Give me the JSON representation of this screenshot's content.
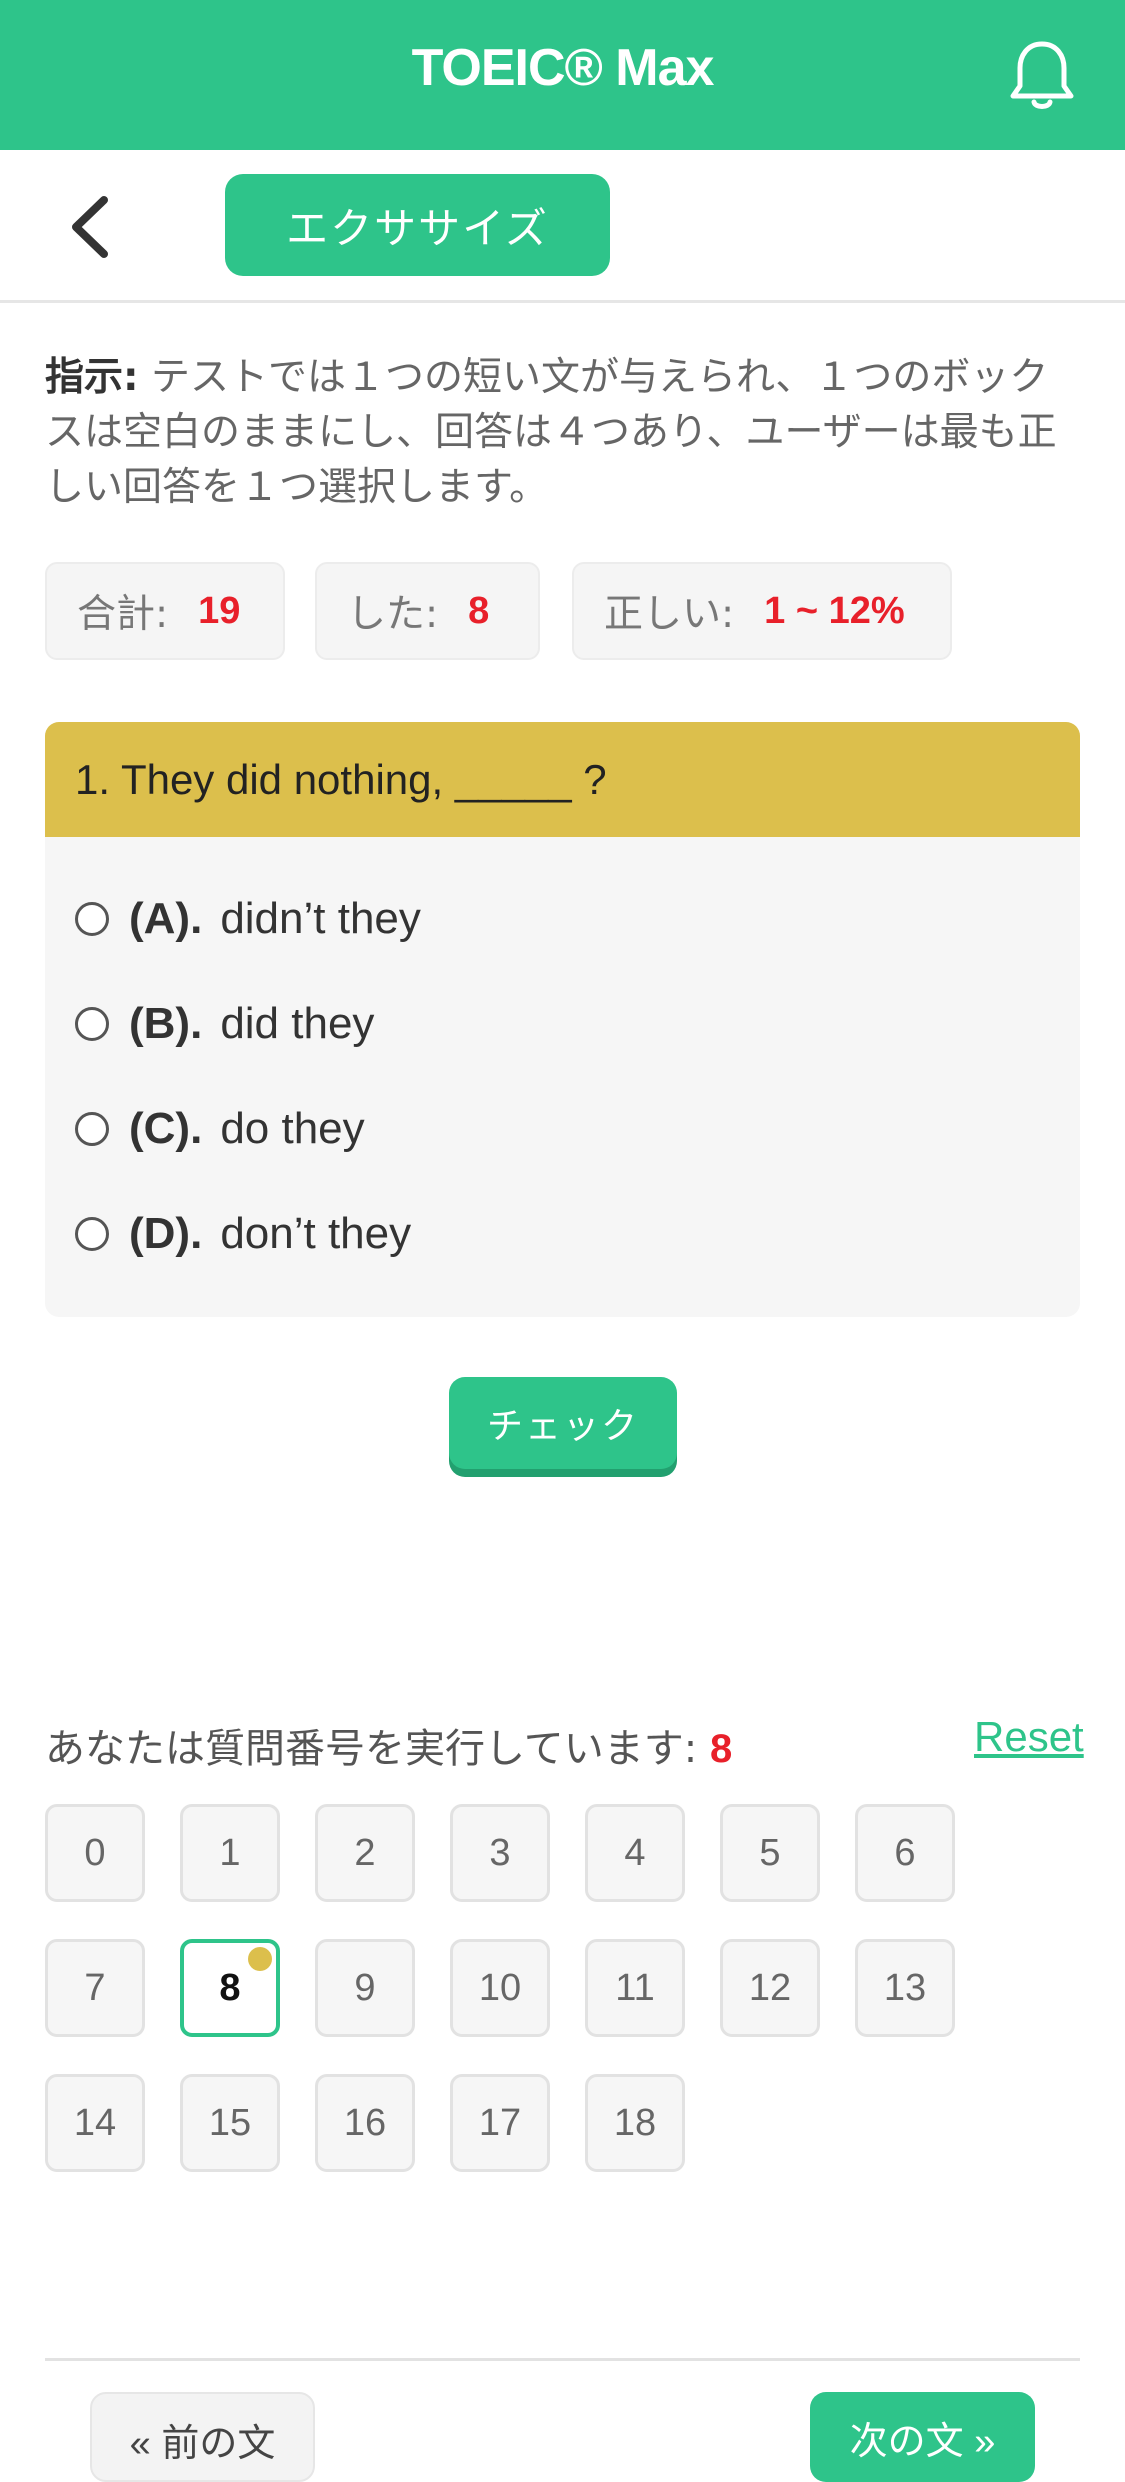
{
  "header": {
    "title": "TOEIC® Max",
    "icon": "bell-icon"
  },
  "subheader": {
    "back_icon": "chevron-left-icon",
    "mode_label": "エクササイズ"
  },
  "instruction": {
    "label": "指示:",
    "text": " テストでは１つの短い文が与えられ、１つのボックスは空白のままにし、回答は４つあり、ユーザーは最も正しい回答を１つ選択します。"
  },
  "stats": {
    "total_label": "合計:",
    "total_value": "19",
    "done_label": "した:",
    "done_value": "8",
    "correct_label": "正しい:",
    "correct_value": "1 ~ 12%"
  },
  "question": {
    "text": "1. They did nothing, _____ ?",
    "options": [
      {
        "key": "(A).",
        "text": "didn’t they"
      },
      {
        "key": "(B).",
        "text": "did they"
      },
      {
        "key": "(C).",
        "text": "do they"
      },
      {
        "key": "(D).",
        "text": "don’t they"
      }
    ]
  },
  "check_label": "チェック",
  "progress": {
    "label": "あなたは質問番号を実行しています:",
    "current": "8",
    "reset_label": "Reset"
  },
  "numbers": [
    "0",
    "1",
    "2",
    "3",
    "4",
    "5",
    "6",
    "7",
    "8",
    "9",
    "10",
    "11",
    "12",
    "13",
    "14",
    "15",
    "16",
    "17",
    "18"
  ],
  "nav": {
    "prev_label": "« 前の文",
    "next_label": "次の文 »"
  },
  "colors": {
    "brand": "#2ec48a",
    "question_header": "#dcbf4c",
    "highlight": "#e8202a"
  }
}
